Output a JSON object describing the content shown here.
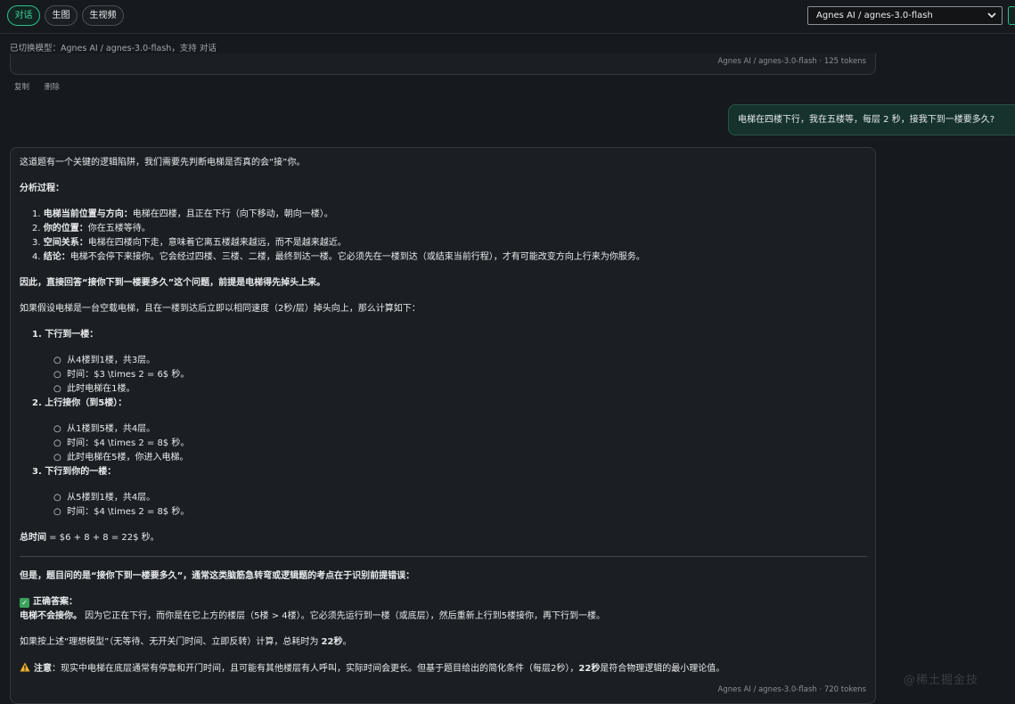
{
  "tabs": [
    {
      "label": "对话",
      "active": true
    },
    {
      "label": "生图",
      "active": false
    },
    {
      "label": "生视频",
      "active": false
    }
  ],
  "model_select": {
    "value": "Agnes AI / agnes-3.0-flash"
  },
  "switch_note": "已切换模型：Agnes AI / agnes-3.0-flash，支持 对话",
  "prev_message": {
    "meta": "Agnes AI / agnes-3.0-flash · 125 tokens"
  },
  "message_actions": {
    "copy": "复制",
    "delete": "删除"
  },
  "user_message": "电梯在四楼下行，我在五楼等，每层 2 秒，接我下到一楼要多久?",
  "ai_message": {
    "intro": "这道题有一个关键的逻辑陷阱，我们需要先判断电梯是否真的会“接”你。",
    "analysis_title": "分析过程：",
    "analysis": [
      {
        "label": "电梯当前位置与方向：",
        "text": "电梯在四楼，且正在下行（向下移动，朝向一楼）。"
      },
      {
        "label": "你的位置：",
        "text": "你在五楼等待。"
      },
      {
        "label": "空间关系：",
        "text": "电梯在四楼向下走，意味着它离五楼越来越远，而不是越来越近。"
      },
      {
        "label": "结论：",
        "text": "电梯不会停下来接你。它会经过四楼、三楼、二楼，最终到达一楼。它必须先在一楼到达（或结束当前行程），才有可能改变方向上行来为你服务。"
      }
    ],
    "therefore": "因此，直接回答“接你下到一楼要多久”这个问题，前提是电梯得先掉头上来。",
    "assumption": "如果假设电梯是一台空载电梯，且在一楼到达后立即以相同速度（2秒/层）掉头向上，那么计算如下：",
    "steps": [
      {
        "title": "下行到一楼：",
        "items": [
          "从4楼到1楼，共3层。",
          "时间：$3 \\times 2 = 6$ 秒。",
          "此时电梯在1楼。"
        ]
      },
      {
        "title": "上行接你（到5楼）：",
        "items": [
          "从1楼到5楼，共4层。",
          "时间：$4 \\times 2 = 8$ 秒。",
          "此时电梯在5楼，你进入电梯。"
        ]
      },
      {
        "title": "下行到你的一楼：",
        "items": [
          "从5楼到1楼，共4层。",
          "时间：$4 \\times 2 = 8$ 秒。"
        ]
      }
    ],
    "total_label": "总时间",
    "total_text": " = $6 + 8 + 8 = 22$ 秒。",
    "but": "但是，题目问的是“接你下到一楼要多久”，通常这类脑筋急转弯或逻辑题的考点在于识别前提错误：",
    "correct_label": "正确答案：",
    "correct_bold": "电梯不会接你。",
    "correct_text": " 因为它正在下行，而你是在它上方的楼层（5楼 > 4楼）。它必须先运行到一楼（或底层），然后重新上行到5楼接你，再下行到一楼。",
    "ideal_text": "如果按上述“理想模型”（无等待、无开关门时间、立即反转）计算，总耗时为 ",
    "ideal_value": "22秒",
    "ideal_end": "。",
    "note_label": "注意",
    "note_text": "：现实中电梯在底层通常有停靠和开门时间，且可能有其他楼层有人呼叫，实际时间会更长。但基于题目给出的简化条件（每层2秒），",
    "note_bold": "22秒",
    "note_end": "是符合物理逻辑的最小理论值。",
    "meta": "Agnes AI / agnes-3.0-flash · 720 tokens"
  },
  "watermark": "@稀土掘金技"
}
